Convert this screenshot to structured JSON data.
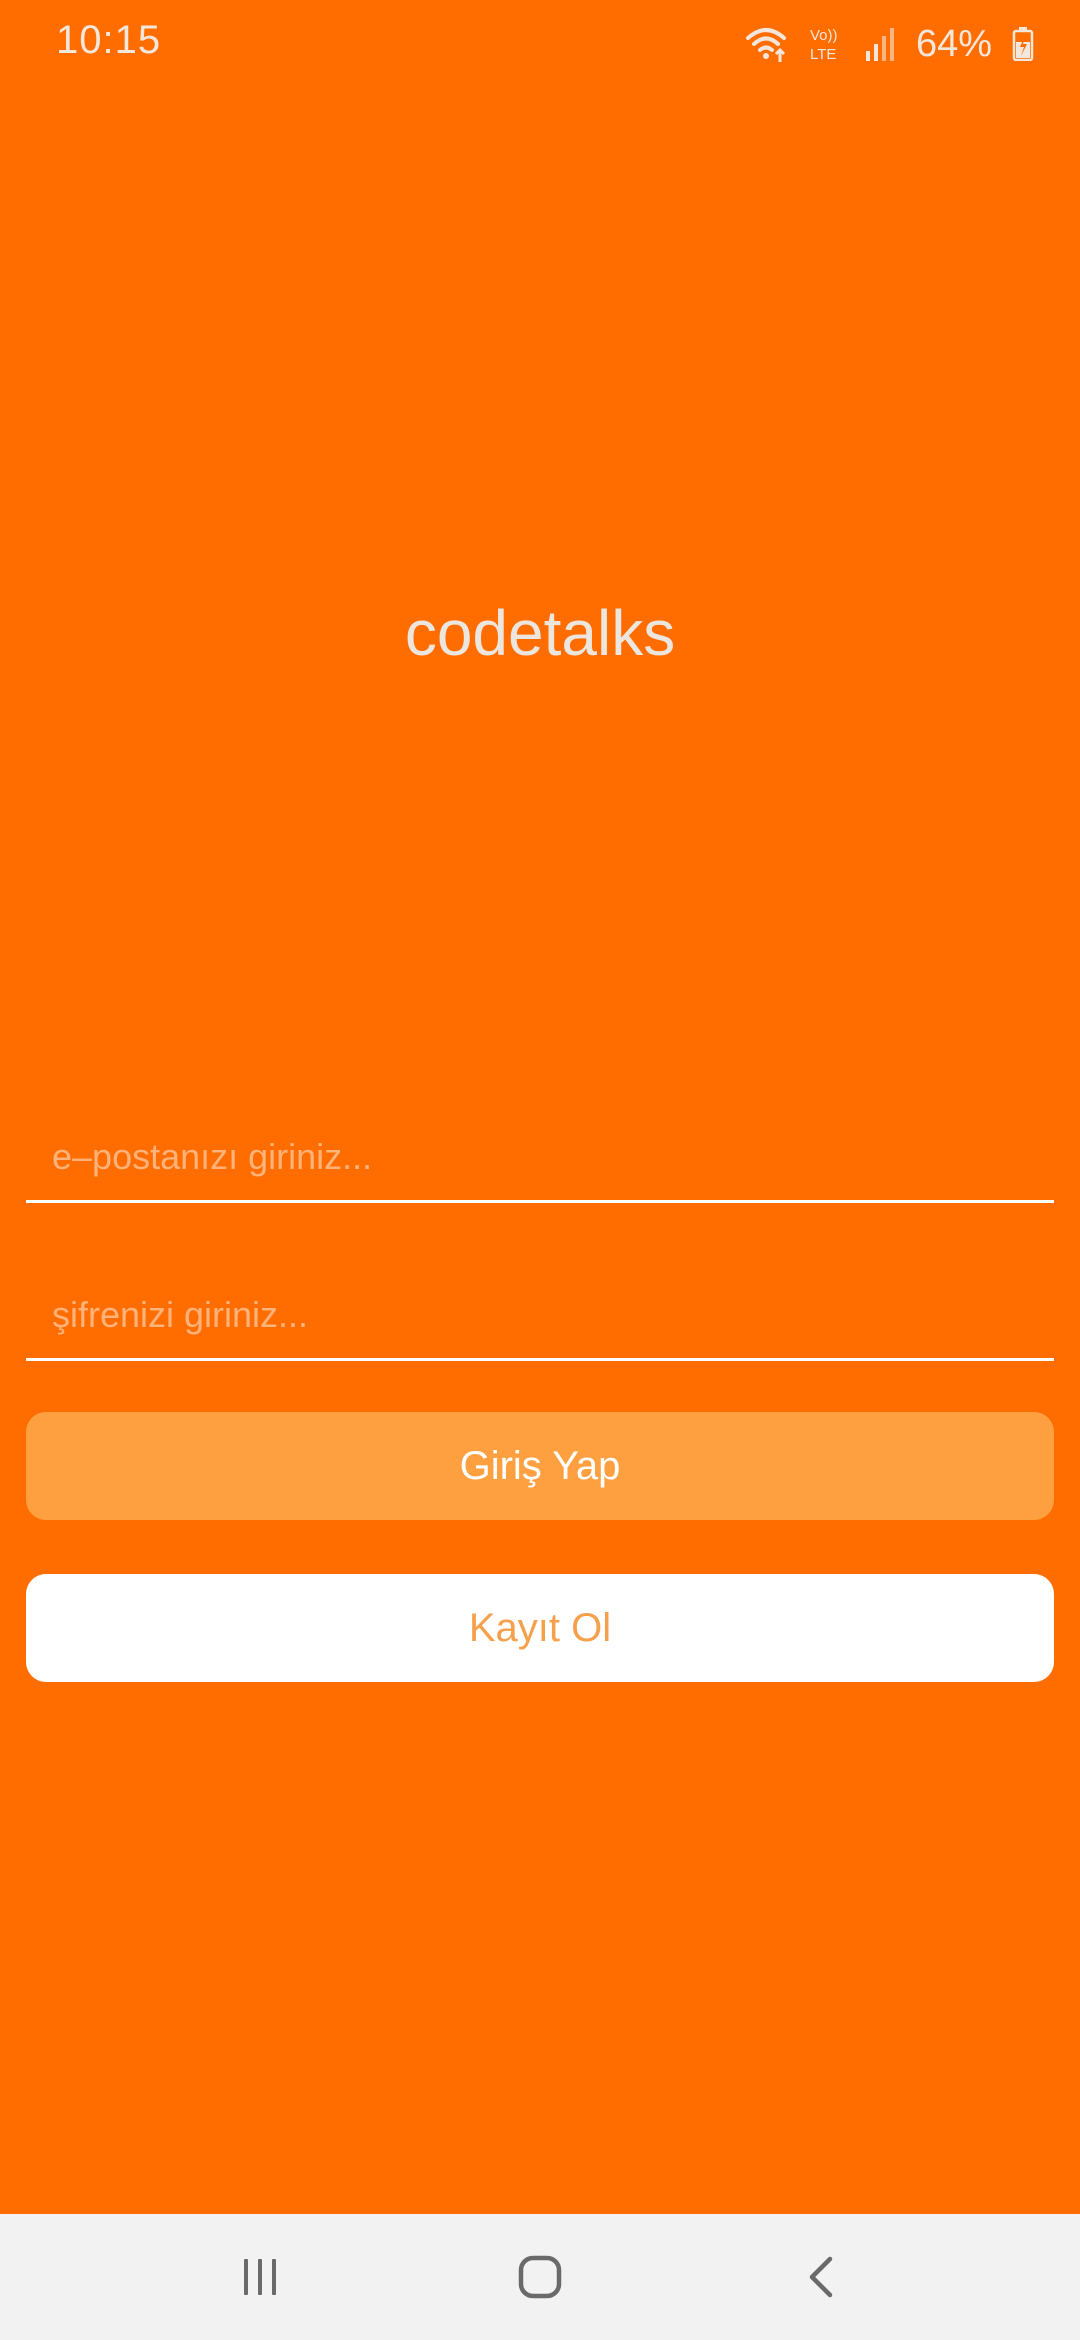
{
  "status_bar": {
    "time": "10:15",
    "battery_percent": "64%",
    "icons": [
      "wifi-icon",
      "volte-icon",
      "signal-icon",
      "battery-charging-icon"
    ],
    "volte_label_top": "Vo))",
    "volte_label_bottom": "LTE"
  },
  "app": {
    "title": "codetalks"
  },
  "form": {
    "email_placeholder": "e–postanızı giriniz...",
    "password_placeholder": "şifrenizi giriniz...",
    "login_label": "Giriş Yap",
    "register_label": "Kayıt Ol"
  },
  "colors": {
    "background": "#ff6d00",
    "login_button": "#ffa040",
    "register_button": "#ffffff",
    "register_text": "#f6a04c",
    "nav_bar": "#f2f2f2"
  },
  "nav_bar": {
    "icons": [
      "recent-apps-icon",
      "home-icon",
      "back-icon"
    ]
  }
}
